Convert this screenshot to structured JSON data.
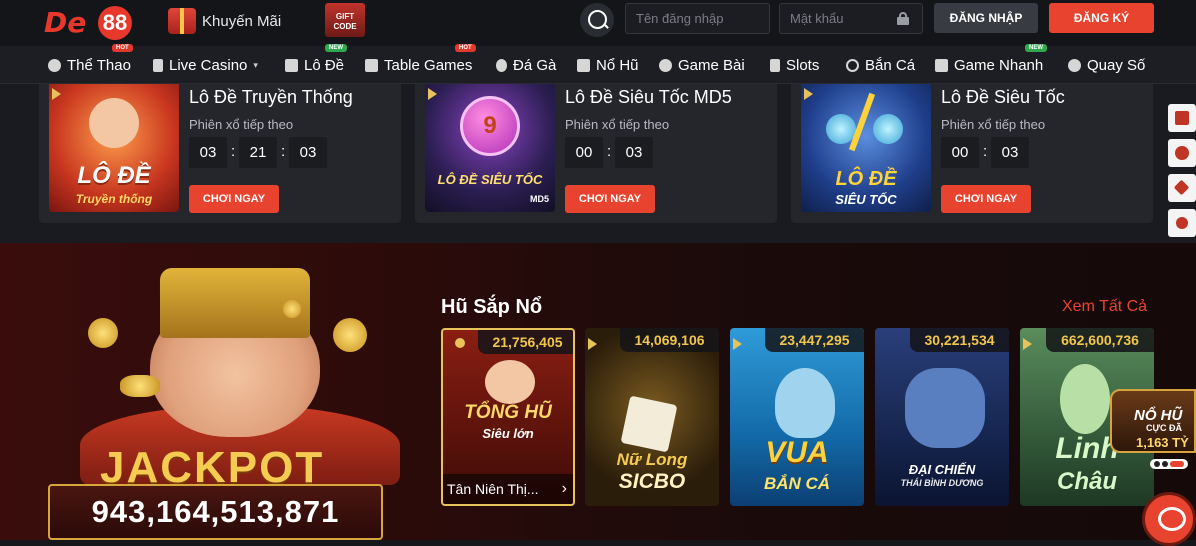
{
  "header": {
    "logo_text": "De88",
    "promo_label": "Khuyến Mãi",
    "giftcode_label": "GIFT CODE",
    "username_placeholder": "Tên đăng nhập",
    "password_placeholder": "Mật khẩu",
    "login_label": "ĐĂNG NHẬP",
    "register_label": "ĐĂNG KÝ"
  },
  "nav": {
    "items": [
      {
        "label": "Thể Thao",
        "icon": "soccer-ball-icon",
        "badge": "HOT"
      },
      {
        "label": "Live Casino",
        "icon": "card-icon",
        "badge": ""
      },
      {
        "label": "Lô Đề",
        "icon": "calendar-icon",
        "badge": "NEW"
      },
      {
        "label": "Table Games",
        "icon": "dice-icon",
        "badge": "HOT"
      },
      {
        "label": "Đá Gà",
        "icon": "rooster-icon",
        "badge": ""
      },
      {
        "label": "Nổ Hũ",
        "icon": "slot-machine-icon",
        "badge": ""
      },
      {
        "label": "Game Bài",
        "icon": "club-icon",
        "badge": ""
      },
      {
        "label": "Slots",
        "icon": "seven-icon",
        "badge": ""
      },
      {
        "label": "Bắn Cá",
        "icon": "target-icon",
        "badge": ""
      },
      {
        "label": "Game Nhanh",
        "icon": "rocket-icon",
        "badge": "NEW"
      },
      {
        "label": "Quay Số",
        "icon": "lottery-icon",
        "badge": ""
      }
    ]
  },
  "lottery": {
    "next_label": "Phiên xổ tiếp theo",
    "play_label": "CHƠI NGAY",
    "cards": [
      {
        "title": "Lô Đề Truyền Thống",
        "thumb_line1": "LÔ ĐỀ",
        "thumb_line2": "Truyền thống",
        "h": "03",
        "m": "21",
        "s": "03"
      },
      {
        "title": "Lô Đề Siêu Tốc MD5",
        "thumb_line1": "LÔ ĐỀ SIÊU TỐC",
        "thumb_line2": "MD5",
        "ball": "9",
        "m": "00",
        "s": "03"
      },
      {
        "title": "Lô Đề Siêu Tốc",
        "thumb_line1": "LÔ ĐỀ",
        "thumb_line2": "SIÊU TỐC",
        "m": "00",
        "s": "03"
      }
    ]
  },
  "jackpot": {
    "word": "JACKPOT",
    "value": "943,164,513,871"
  },
  "pots": {
    "title": "Hũ Sắp Nổ",
    "see_all": "Xem Tất Cả",
    "games": [
      {
        "amount": "21,756,405",
        "art_line1": "TỔNG HŨ",
        "art_line2": "Siêu lớn",
        "caption": "Tân Niên Thị...",
        "active": true
      },
      {
        "amount": "14,069,106",
        "art_line1": "Nữ Long",
        "art_line2": "SICBO"
      },
      {
        "amount": "23,447,295",
        "art_line1": "VUA",
        "art_line2": "BẮN CÁ"
      },
      {
        "amount": "30,221,534",
        "art_line1": "ĐẠI CHIẾN",
        "art_line2": "THÁI BÌNH DƯƠNG"
      },
      {
        "amount": "662,600,736",
        "art_line1": "Linh",
        "art_line2": "Châu"
      }
    ]
  },
  "float_jackpot": {
    "line1": "NỔ HŨ",
    "line2": "CỰC ĐÃ",
    "line3": "1,163 TỶ"
  }
}
